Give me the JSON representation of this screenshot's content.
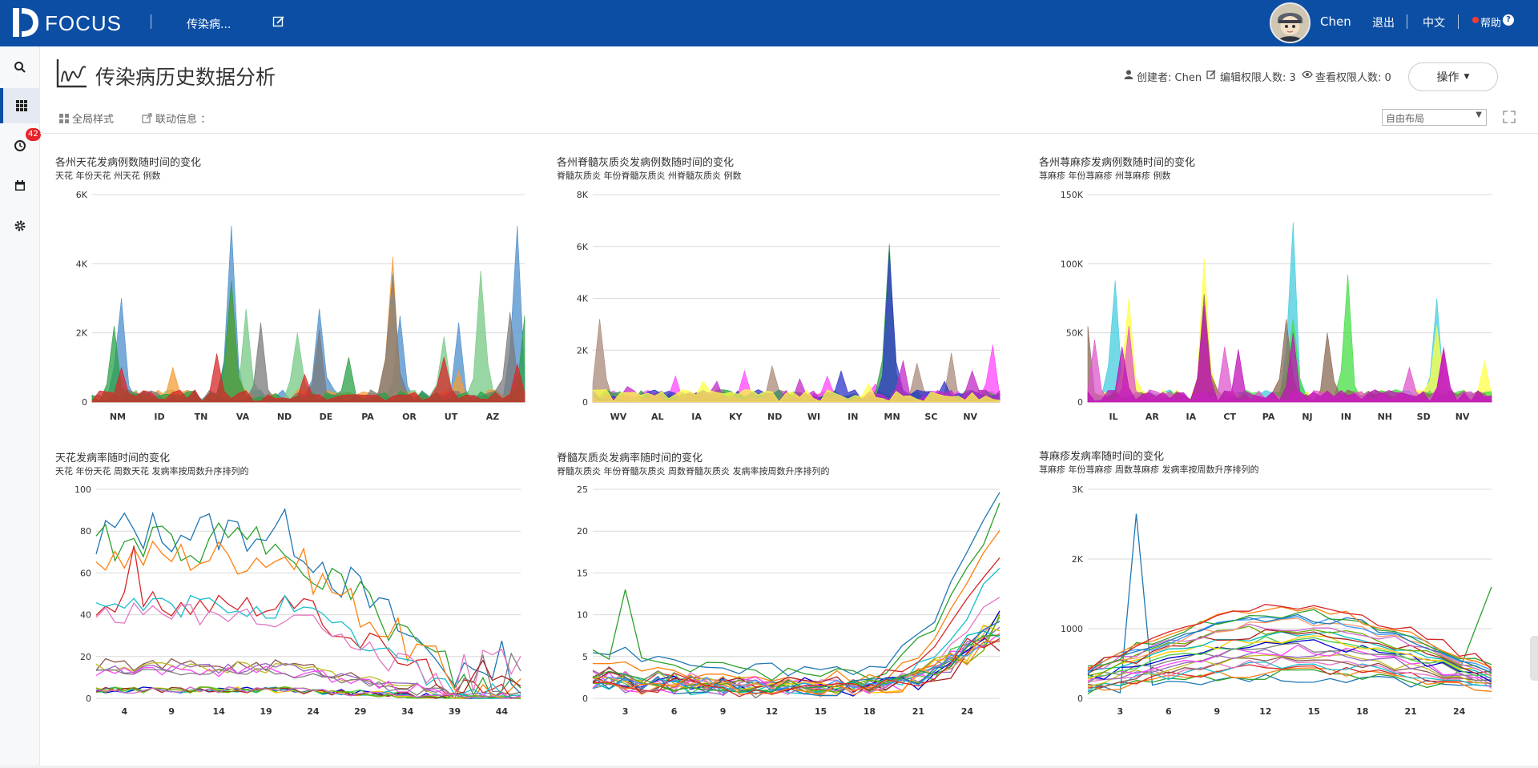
{
  "app": {
    "logo_text": "FOCUS",
    "current_tab": "传染病...",
    "brand_color": "#0c4ea4"
  },
  "header": {
    "user_name": "Chen",
    "logout": "退出",
    "language": "中文",
    "help": "帮助"
  },
  "sidebar": {
    "items": [
      {
        "icon": "search-icon"
      },
      {
        "icon": "grid-icon"
      },
      {
        "icon": "clock-icon",
        "badge": "42"
      },
      {
        "icon": "calendar-icon"
      },
      {
        "icon": "gear-icon"
      }
    ]
  },
  "page": {
    "title": "传染病历史数据分析",
    "creator": "创建者: Chen",
    "edit_count": "编辑权限人数: 3",
    "view_count": "查看权限人数: 0",
    "action_button": "操作",
    "global_style": "全局样式",
    "link_info": "联动信息 ：",
    "layout_select": "自由布局"
  },
  "chart_data": [
    {
      "type": "area",
      "title": "各州天花发病例数随时间的变化",
      "subtitle": "天花 年份天花 州天花 例数",
      "x_ticks": [
        "NM",
        "ID",
        "TN",
        "VA",
        "ND",
        "DE",
        "PA",
        "OR",
        "UT",
        "AZ"
      ],
      "y_ticks": [
        "0",
        "2K",
        "4K",
        "6K"
      ],
      "ylim": [
        0,
        6000
      ],
      "n_points": 60,
      "series": [
        {
          "color": "#4e8fcb",
          "peaks": [
            [
              4,
              3000
            ],
            [
              19,
              5100
            ],
            [
              31,
              2700
            ],
            [
              42,
              2500
            ],
            [
              50,
              2300
            ],
            [
              58,
              5100
            ]
          ]
        },
        {
          "color": "#76c884",
          "peaks": [
            [
              21,
              2700
            ],
            [
              28,
              2000
            ],
            [
              48,
              1900
            ],
            [
              53,
              3800
            ]
          ]
        },
        {
          "color": "#f39c36",
          "peaks": [
            [
              11,
              1000
            ],
            [
              19,
              3200
            ],
            [
              41,
              4200
            ],
            [
              50,
              900
            ]
          ]
        },
        {
          "color": "#7a7a7a",
          "peaks": [
            [
              23,
              2300
            ],
            [
              31,
              2100
            ],
            [
              41,
              3700
            ],
            [
              57,
              2600
            ]
          ]
        },
        {
          "color": "#2aa047",
          "peaks": [
            [
              3,
              2200
            ],
            [
              19,
              3500
            ],
            [
              35,
              1300
            ],
            [
              59,
              2500
            ]
          ]
        },
        {
          "color": "#d62728",
          "peaks": [
            [
              4,
              1000
            ],
            [
              17,
              1400
            ],
            [
              29,
              800
            ],
            [
              48,
              1300
            ],
            [
              58,
              1100
            ]
          ]
        }
      ]
    },
    {
      "type": "area",
      "title": "各州脊髓灰质炎发病例数随时间的变化",
      "subtitle": "脊髓灰质炎 年份脊髓灰质炎 州脊髓灰质炎 例数",
      "x_ticks": [
        "WV",
        "AL",
        "IA",
        "KY",
        "ND",
        "WI",
        "IN",
        "MN",
        "SC",
        "NV"
      ],
      "y_ticks": [
        "0",
        "2K",
        "4K",
        "6K",
        "8K"
      ],
      "ylim": [
        0,
        8000
      ],
      "n_points": 60,
      "series": [
        {
          "color": "#a9897a",
          "peaks": [
            [
              1,
              3200
            ],
            [
              26,
              1400
            ],
            [
              47,
              1500
            ],
            [
              52,
              1900
            ]
          ]
        },
        {
          "color": "#ff44ff",
          "peaks": [
            [
              12,
              1000
            ],
            [
              22,
              1200
            ],
            [
              34,
              1000
            ],
            [
              41,
              700
            ],
            [
              58,
              2200
            ]
          ]
        },
        {
          "color": "#2aa047",
          "peaks": [
            [
              43,
              6100
            ]
          ]
        },
        {
          "color": "#2f35c8",
          "peaks": [
            [
              36,
              1200
            ],
            [
              43,
              5800
            ],
            [
              51,
              800
            ]
          ]
        },
        {
          "color": "#c22ac6",
          "peaks": [
            [
              5,
              600
            ],
            [
              18,
              800
            ],
            [
              30,
              900
            ],
            [
              45,
              1600
            ],
            [
              55,
              1200
            ]
          ]
        },
        {
          "color": "#ffff44",
          "peaks": [
            [
              16,
              800
            ],
            [
              40,
              700
            ]
          ]
        }
      ]
    },
    {
      "type": "area",
      "title": "各州荨麻疹发病例数随时间的变化",
      "subtitle": "荨麻疹 年份荨麻疹 州荨麻疹 例数",
      "x_ticks": [
        "IL",
        "AR",
        "IA",
        "CT",
        "PA",
        "NJ",
        "IN",
        "NH",
        "SD",
        "NV"
      ],
      "y_ticks": [
        "0",
        "50K",
        "100K",
        "150K"
      ],
      "ylim": [
        0,
        150000
      ],
      "n_points": 60,
      "series": [
        {
          "color": "#44ccdd",
          "peaks": [
            [
              4,
              88000
            ],
            [
              30,
              130000
            ],
            [
              51,
              75000
            ]
          ]
        },
        {
          "color": "#ffff44",
          "peaks": [
            [
              6,
              75000
            ],
            [
              17,
              104000
            ],
            [
              51,
              55000
            ],
            [
              58,
              30000
            ]
          ]
        },
        {
          "color": "#44dd44",
          "peaks": [
            [
              30,
              60000
            ],
            [
              38,
              92000
            ]
          ]
        },
        {
          "color": "#8a6a55",
          "peaks": [
            [
              0,
              55000
            ],
            [
              17,
              78000
            ],
            [
              29,
              60000
            ],
            [
              35,
              50000
            ]
          ]
        },
        {
          "color": "#dd55cc",
          "peaks": [
            [
              1,
              45000
            ],
            [
              6,
              55000
            ],
            [
              20,
              40000
            ],
            [
              47,
              25000
            ],
            [
              52,
              40000
            ]
          ]
        },
        {
          "color": "#c010b8",
          "peaks": [
            [
              5,
              40000
            ],
            [
              17,
              70000
            ],
            [
              22,
              38000
            ],
            [
              30,
              50000
            ],
            [
              52,
              38000
            ]
          ]
        }
      ]
    },
    {
      "type": "line",
      "title": "天花发病率随时间的变化",
      "subtitle": "天花 年份天花 周数天花 发病率按周数升序排列的",
      "x_ticks": [
        "4",
        "9",
        "14",
        "19",
        "24",
        "29",
        "34",
        "39",
        "44"
      ],
      "y_ticks": [
        "0",
        "20",
        "40",
        "60",
        "80",
        "100"
      ],
      "ylim": [
        0,
        100
      ],
      "x_range": [
        1,
        46
      ]
    },
    {
      "type": "line",
      "title": "脊髓灰质炎发病率随时间的变化",
      "subtitle": "脊髓灰质炎 年份脊髓灰质炎 周数脊髓灰质炎 发病率按周数升序排列的",
      "x_ticks": [
        "3",
        "6",
        "9",
        "12",
        "15",
        "18",
        "21",
        "24"
      ],
      "y_ticks": [
        "0",
        "5",
        "10",
        "15",
        "20",
        "25"
      ],
      "ylim": [
        0,
        25
      ],
      "x_range": [
        1,
        26
      ]
    },
    {
      "type": "line",
      "title": "荨麻疹发病率随时间的变化",
      "subtitle": "荨麻疹 年份荨麻疹 周数荨麻疹 发病率按周数升序排列的",
      "x_ticks": [
        "3",
        "6",
        "9",
        "12",
        "15",
        "18",
        "21",
        "24"
      ],
      "y_ticks": [
        "0",
        "1000",
        "2K",
        "3K"
      ],
      "ylim": [
        0,
        3000
      ],
      "x_range": [
        1,
        26
      ]
    }
  ]
}
